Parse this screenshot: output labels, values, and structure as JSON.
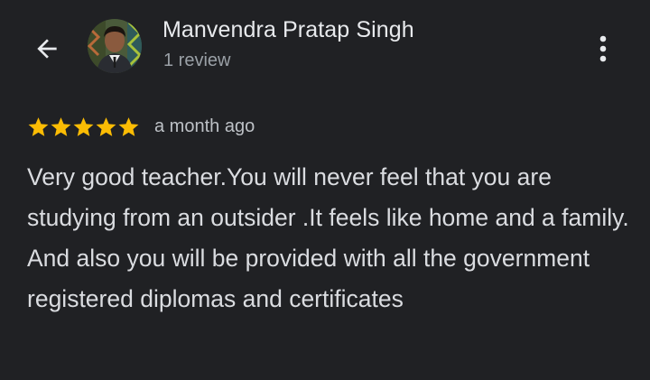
{
  "header": {
    "back_icon": "arrow-back-icon",
    "avatar_icon": "user-avatar",
    "reviewer_name": "Manvendra Pratap Singh",
    "review_count": "1 review",
    "more_icon": "more-vert-icon"
  },
  "review": {
    "rating": 5,
    "max_rating": 5,
    "star_color": "#fbbc04",
    "time": "a month ago",
    "paragraphs": [
      "Very good teacher.You will never feel that you are studying from an outsider .It feels like home and a family.",
      "And also you will be provided with all the government registered diplomas and certificates"
    ]
  }
}
